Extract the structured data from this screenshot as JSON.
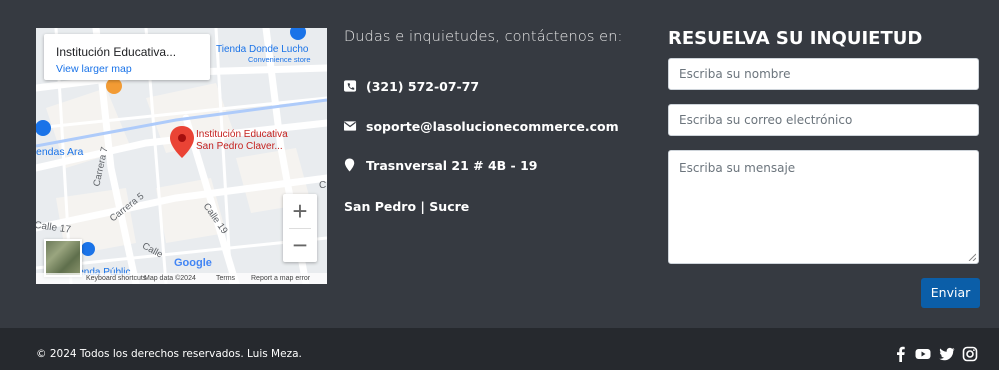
{
  "map": {
    "place_title": "Institución Educativa...",
    "view_larger": "View larger map",
    "pin_label_1": "Institución Educativa",
    "pin_label_2": "San Pedro Claver...",
    "poi_store": "Tienda Donde Lucho",
    "poi_store_sub": "Convenience store",
    "street_carrera7": "Carrera 7",
    "street_carrera5": "Carrera 5",
    "street_calle19": "Calle 19",
    "street_calle17": "Calle 17",
    "street_tiendas": "endas Ara",
    "street_calle_b": "Calle",
    "street_bottom": "ienda Públic",
    "google": "Google",
    "footer_shortcuts": "Keyboard shortcuts",
    "footer_data": "Map data ©2024",
    "footer_terms": "Terms",
    "footer_report": "Report a map error",
    "zoom_in": "+",
    "zoom_out": "−"
  },
  "contact": {
    "heading": "Dudas e inquietudes, contáctenos en:",
    "phone": "(321) 572-07-77",
    "email": "soporte@lasolucionecommerce.com",
    "address": "Trasnversal 21 # 4B - 19",
    "city": "San Pedro | Sucre"
  },
  "form": {
    "title": "RESUELVA SU INQUIETUD",
    "name_placeholder": "Escriba su nombre",
    "email_placeholder": "Escriba su correo electrónico",
    "message_placeholder": "Escriba su mensaje",
    "send_label": "Enviar"
  },
  "footer": {
    "copyright": "© 2024 Todos los derechos reservados. Luis Meza."
  },
  "colors": {
    "background": "#363a41",
    "footer_bg": "#26292e",
    "button": "#0b5ea8",
    "map_pin": "#ea4335",
    "map_link": "#1a73e8"
  },
  "icons": [
    "phone-square-icon",
    "envelope-icon",
    "map-marker-icon",
    "facebook-icon",
    "youtube-icon",
    "twitter-icon",
    "instagram-icon"
  ]
}
